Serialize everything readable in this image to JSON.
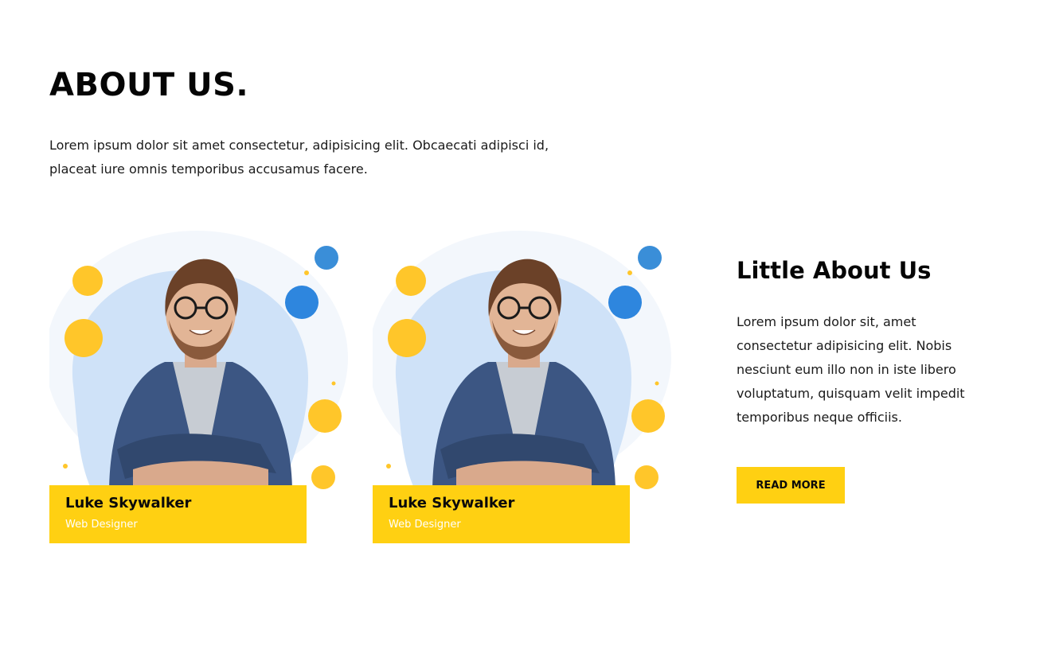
{
  "about": {
    "title": "ABOUT US.",
    "intro": "Lorem ipsum dolor sit amet consectetur, adipisicing elit. Obcaecati adipisci id, placeat iure omnis temporibus accusamus facere."
  },
  "team": [
    {
      "name": "Luke Skywalker",
      "role": "Web Designer"
    },
    {
      "name": "Luke Skywalker",
      "role": "Web Designer"
    }
  ],
  "side": {
    "title": "Little About Us",
    "text": "Lorem ipsum dolor sit, amet consectetur adipisicing elit. Nobis nesciunt eum illo non in iste libero voluptatum, quisquam velit impedit temporibus neque officiis.",
    "button_label": "READ MORE"
  },
  "colors": {
    "accent": "#ffd012",
    "blue_dot": "#2e86de",
    "blob": "#cfe2f8"
  }
}
